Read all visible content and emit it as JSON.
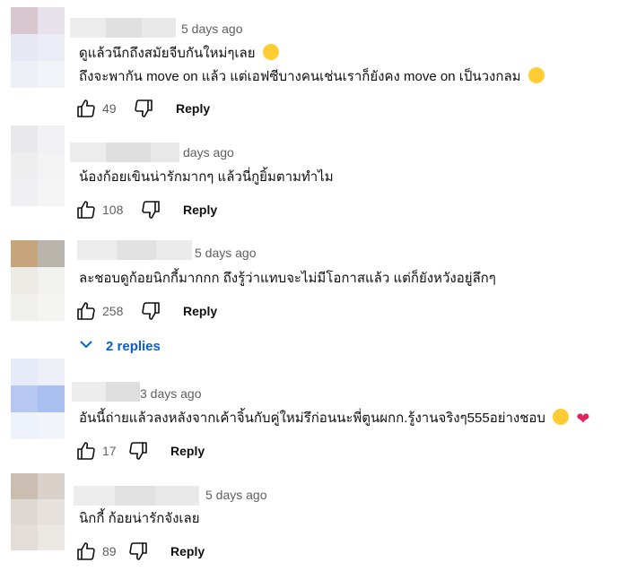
{
  "comments": [
    {
      "time": "5 days ago",
      "lines": [
        "ดูแล้วนึกถึงสมัยจีบกันใหม่ๆเลย",
        "ถึงจะพากัน move on แล้ว แต่เอฟซีบางคนเช่นเราก็ยังคง move on เป็นวงกลม"
      ],
      "likes": "49",
      "reply_label": "Reply",
      "avatar_colors": [
        "#d9c7cf",
        "#e7e1ec",
        "#e6e8f4",
        "#ecedf6",
        "#eef0f7",
        "#f2f3f8"
      ]
    },
    {
      "time": "days ago",
      "lines": [
        "น้องก้อยเขินน่ารักมากๆ แล้วนี่กูยิ้มตามทำไม"
      ],
      "likes": "108",
      "reply_label": "Reply",
      "avatar_colors": [
        "#e9e9ec",
        "#f1f1f3",
        "#eeeeef",
        "#f3f3f4",
        "#f0f0f2",
        "#f5f5f6"
      ]
    },
    {
      "time": "5 days ago",
      "lines": [
        "ละชอบดูก้อยนิกกี้มากกก ถึงรู้ว่าแทบจะไม่มีโอกาสแล้ว แต่ก็ยังหวังอยู่ลึกๆ"
      ],
      "likes": "258",
      "reply_label": "Reply",
      "avatar_colors": [
        "#c8a47c",
        "#b9b4ac",
        "#ecebe6",
        "#f1f1ef",
        "#efefec",
        "#f4f4f2"
      ]
    },
    {
      "time": "3 days ago",
      "lines": [
        "อันนี้ถ่ายแล้วลงหลังจากเค้าจิ้นกับคู่ใหม่รึก่อนนะพี่ตูนผกก.รู้งานจริงๆ555อย่างชอบ"
      ],
      "likes": "17",
      "reply_label": "Reply",
      "avatar_colors": [
        "#e6ebfa",
        "#eef0f8",
        "#b6c8f1",
        "#a9c0f0",
        "#eef2fb",
        "#f2f4fb"
      ]
    },
    {
      "time": "5 days ago",
      "lines": [
        "นิกกี้ ก้อยน่ารักจังเลย"
      ],
      "likes": "89",
      "reply_label": "Reply",
      "avatar_colors": [
        "#cbbdb2",
        "#dad2ca",
        "#ded8d2",
        "#e6e1dd",
        "#e2ddd8",
        "#ebe7e3"
      ]
    }
  ],
  "replies_toggle": {
    "label": "2 replies",
    "icon": "chevron-down-icon"
  },
  "icons": {
    "like": "thumb-up-icon",
    "dislike": "thumb-down-icon",
    "emoji1": "laughing-emoji",
    "emoji2": "sweat-smile-emoji",
    "emoji3": "smile-emoji",
    "heart": "red-heart"
  },
  "colors": {
    "link": "#065fd4",
    "meta": "#606060",
    "text": "#0f0f0f",
    "heart": "#e0245e",
    "emoji": "#ffcc33"
  }
}
